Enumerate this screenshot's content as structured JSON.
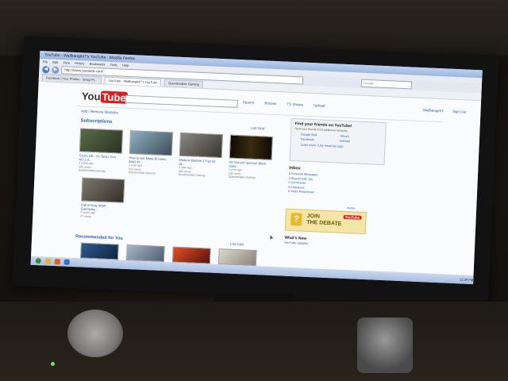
{
  "browser": {
    "window_title": "YouTube - Wallbangit47's YouTube - Mozilla Firefox",
    "menu": [
      "File",
      "Edit",
      "View",
      "History",
      "Bookmarks",
      "Tools",
      "Help"
    ],
    "url": "http://www.youtube.com/",
    "search_placeholder": "Google",
    "tabs": [
      "Facebook | Your Photos - Setup Pr...",
      "YouTube - Wallbangit47's YouTube",
      "Questionable Gaming"
    ]
  },
  "youtube": {
    "logo_you": "You",
    "logo_tube": "Tube",
    "nav": [
      "Search",
      "Browse",
      "TV Shows",
      "Upload"
    ],
    "user_links": [
      "Wallbangit47",
      "Sign Out"
    ],
    "add_remove": "Add / Remove Modules",
    "subscriptions_title": "Subscriptions",
    "subs_controls": "List   Grid",
    "videos": [
      {
        "title": "Crysis HD - PL Tanks Test HD 2.0...",
        "meta": [
          "2 years ago",
          "245 views",
          "Questionable Gaming"
        ],
        "color": "#3b4a32"
      },
      {
        "title": "How to Get Metal Bl Holes MW2 Pt...",
        "meta": [
          "1 year ago",
          "512 views",
          "Questionable Gaming"
        ],
        "color": "#4f6a7d"
      },
      {
        "title": "Modern Warfare 2 Tips for all...",
        "meta": [
          "1 year ago",
          "301 views",
          "Questionable Gaming"
        ],
        "color": "#5d5a56"
      },
      {
        "title": "My Second Spencer Black video",
        "meta": [
          "1 year ago",
          "188 views",
          "Questionable Gaming"
        ],
        "color": "#1a1208"
      },
      {
        "title": "Call of Duty WaW Gameplay...",
        "meta": [
          "2 years ago",
          "97 views"
        ],
        "color": "#5a564e"
      }
    ],
    "recommended_title": "Recommended for You",
    "recommended_controls": "List   Grid",
    "recommended_colors": [
      "#2f5a8f",
      "#7a8fa8",
      "#b8321c",
      "#c8c2b6"
    ],
    "friends_box": {
      "title": "Find your friends on YouTube!",
      "subtitle": "Send your friends from additional networks",
      "services": [
        "Google Mail",
        "Yahoo!",
        "Facebook",
        "Hotmail"
      ],
      "footer": "Learn more | Use email list (opt)"
    },
    "inbox_title": "Inbox",
    "inbox_items": [
      "0 Personal Messages",
      "0 Shared with You",
      "0 Comments",
      "0 Invitations",
      "0 Video Responses"
    ],
    "more_link": "more»",
    "banner": {
      "line1": "JOIN",
      "line2": "THE DEBATE",
      "badge": "YouTube",
      "icon": "?"
    },
    "whats_new_title": "What's New",
    "whats_new_sub": "YouTube Updates"
  },
  "taskbar": {
    "tray_text": "12:34 PM"
  }
}
